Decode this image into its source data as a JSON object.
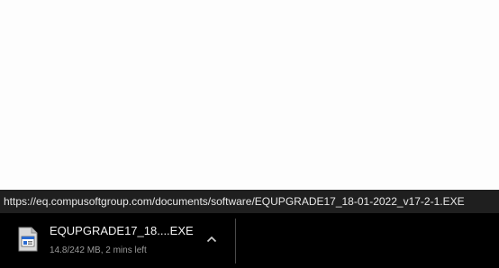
{
  "status_bar": {
    "url": "https://eq.compusoftgroup.com/documents/software/EQUPGRADE17_18-01-2022_v17-2-1.EXE"
  },
  "download_shelf": {
    "item": {
      "file_name": "EQUPGRADE17_18....EXE",
      "status": "14.8/242 MB, 2 mins left",
      "icon": "exe-file-icon",
      "menu_icon": "chevron-up-icon"
    }
  },
  "colors": {
    "shelf_background": "#000000",
    "status_background": "#1f1f1f",
    "file_name": "#f2f2f2",
    "status_text": "#9a9a9a"
  }
}
